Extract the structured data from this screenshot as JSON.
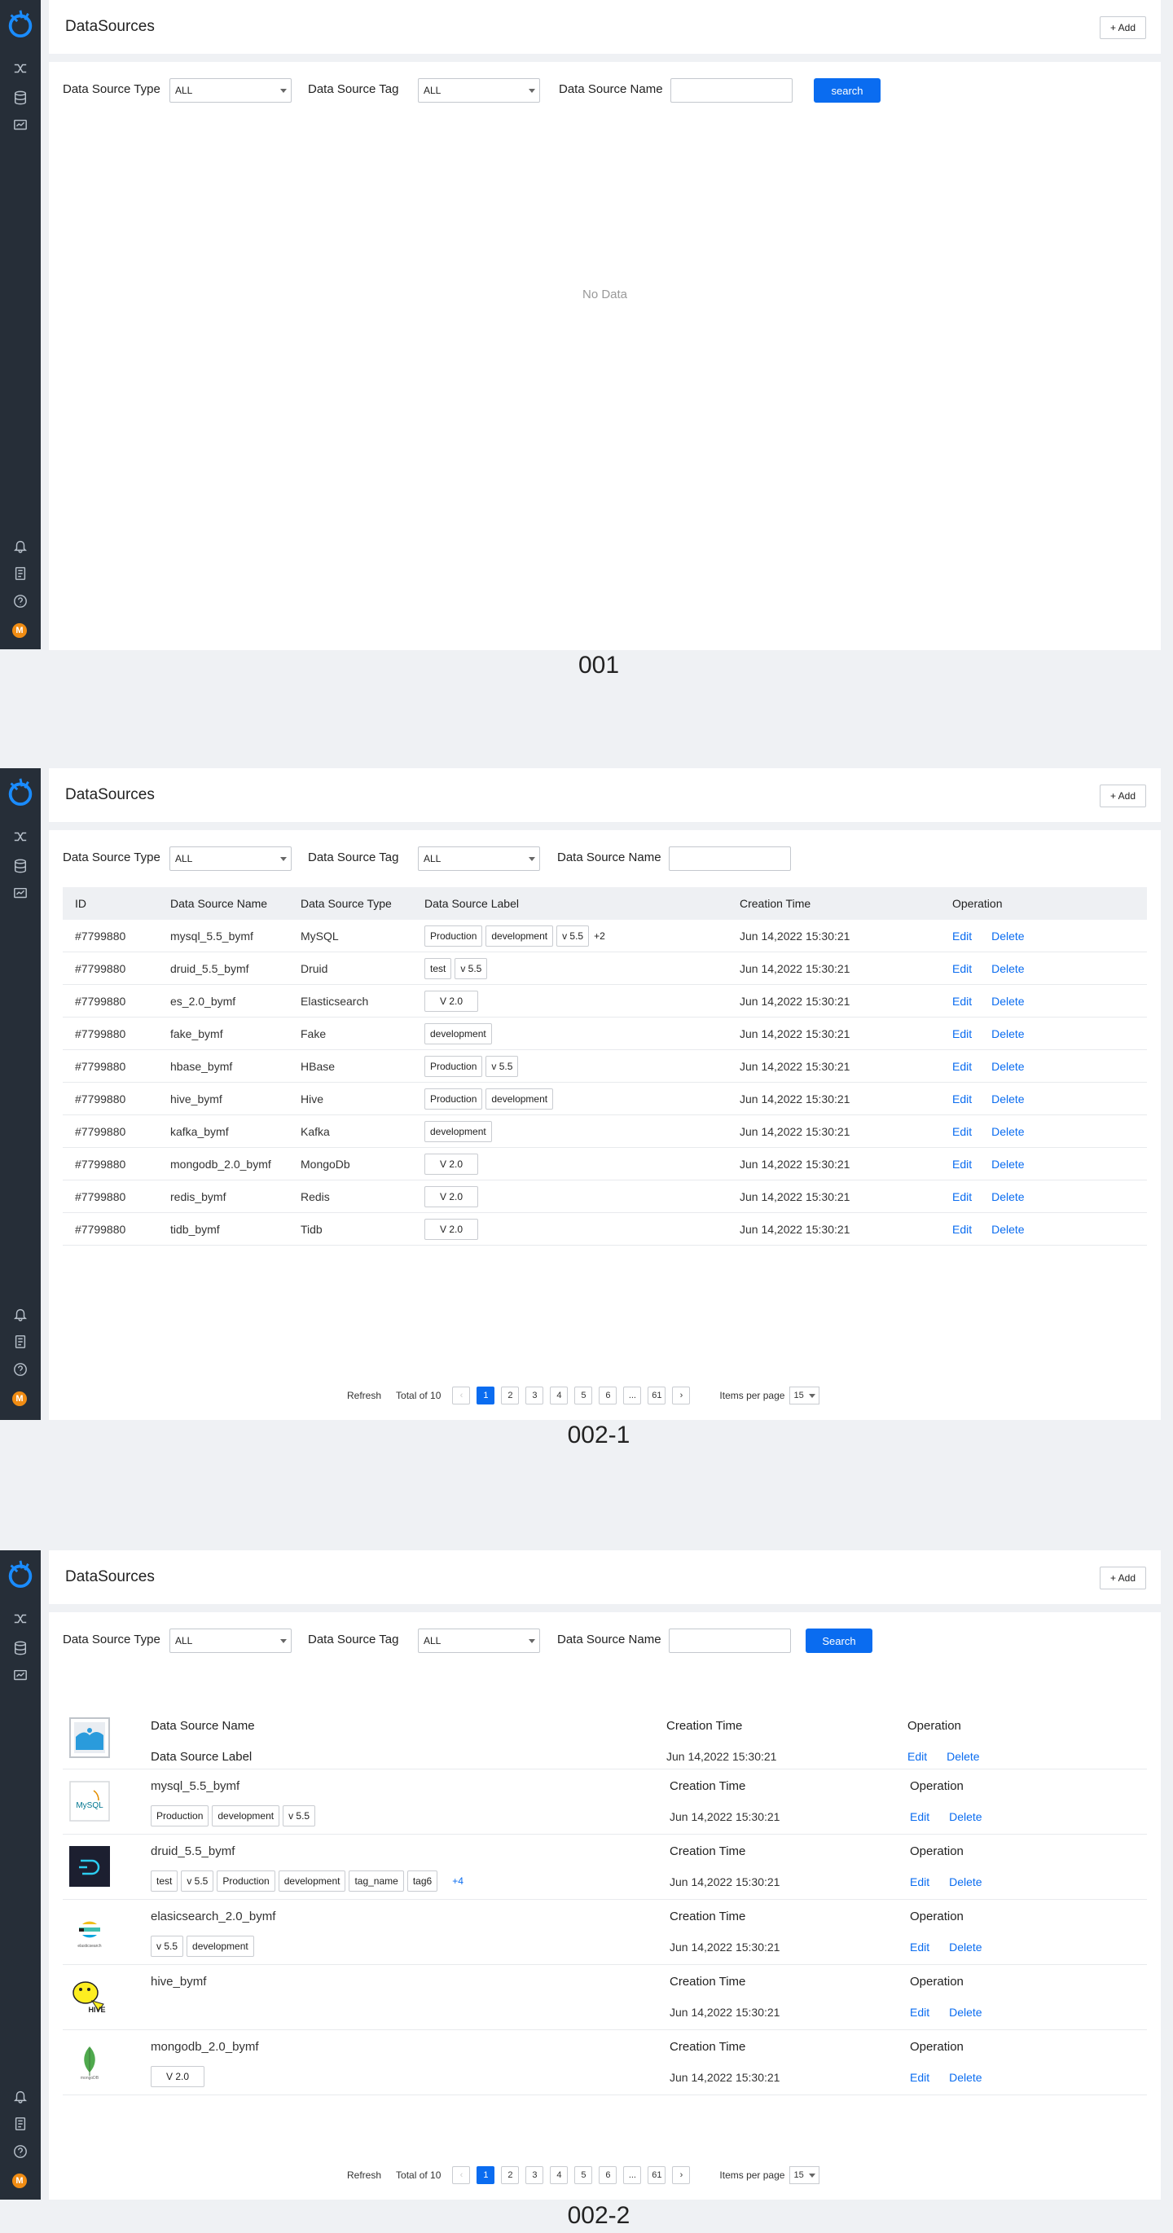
{
  "app": {
    "title": "DataSources",
    "add_label": "+ Add"
  },
  "filters": {
    "type_label": "Data Source Type",
    "tag_label": "Data Source Tag",
    "name_label": "Data Source Name",
    "type_value": "ALL",
    "tag_value": "ALL",
    "search_label_1": "search",
    "search_label_2": "Search"
  },
  "screen1": {
    "no_data": "No Data",
    "caption": "001"
  },
  "screen2": {
    "caption": "002-1",
    "columns": [
      "ID",
      "Data Source Name",
      "Data Source Type",
      "Data Source Label",
      "Creation Time",
      "Operation"
    ],
    "rows": [
      {
        "id": "#7799880",
        "name": "mysql_5.5_bymf",
        "type": "MySQL",
        "tags": [
          "Production",
          "development",
          "v 5.5"
        ],
        "more": "+2",
        "time": "Jun 14,2022 15:30:21"
      },
      {
        "id": "#7799880",
        "name": "druid_5.5_bymf",
        "type": "Druid",
        "tags": [
          "test",
          "v 5.5"
        ],
        "more": "",
        "time": "Jun 14,2022 15:30:21"
      },
      {
        "id": "#7799880",
        "name": "es_2.0_bymf",
        "type": "Elasticsearch",
        "tags": [
          "V 2.0"
        ],
        "more": "",
        "time": "Jun 14,2022 15:30:21"
      },
      {
        "id": "#7799880",
        "name": "fake_bymf",
        "type": "Fake",
        "tags": [
          "development"
        ],
        "more": "",
        "time": "Jun 14,2022 15:30:21"
      },
      {
        "id": "#7799880",
        "name": "hbase_bymf",
        "type": "HBase",
        "tags": [
          "Production",
          "v 5.5"
        ],
        "more": "",
        "time": "Jun 14,2022 15:30:21"
      },
      {
        "id": "#7799880",
        "name": "hive_bymf",
        "type": "Hive",
        "tags": [
          "Production",
          "development"
        ],
        "more": "",
        "time": "Jun 14,2022 15:30:21"
      },
      {
        "id": "#7799880",
        "name": "kafka_bymf",
        "type": "Kafka",
        "tags": [
          "development"
        ],
        "more": "",
        "time": "Jun 14,2022 15:30:21"
      },
      {
        "id": "#7799880",
        "name": "mongodb_2.0_bymf",
        "type": "MongoDb",
        "tags": [
          "V 2.0"
        ],
        "more": "",
        "time": "Jun 14,2022 15:30:21"
      },
      {
        "id": "#7799880",
        "name": "redis_bymf",
        "type": "Redis",
        "tags": [
          "V 2.0"
        ],
        "more": "",
        "time": "Jun 14,2022 15:30:21"
      },
      {
        "id": "#7799880",
        "name": "tidb_bymf",
        "type": "Tidb",
        "tags": [
          "V 2.0"
        ],
        "more": "",
        "time": "Jun 14,2022 15:30:21"
      }
    ]
  },
  "ops": {
    "edit": "Edit",
    "delete": "Delete"
  },
  "pagination": {
    "refresh": "Refresh",
    "total": "Total of 10",
    "pages": [
      "1",
      "2",
      "3",
      "4",
      "5",
      "6",
      "...",
      "61"
    ],
    "items_per_page": "Items per page",
    "per_page_value": "15"
  },
  "screen3": {
    "caption": "002-2",
    "header_card": {
      "name": "Data Source Name",
      "label": "Data Source Label",
      "time_label": "Creation Time",
      "time": "Jun 14,2022 15:30:21",
      "op_label": "Operation"
    },
    "cards": [
      {
        "name": "mysql_5.5_bymf",
        "icon": "mysql-logo-icon",
        "tags": [
          "Production",
          "development",
          "v 5.5"
        ],
        "more": "",
        "time_label": "Creation Time",
        "time": "Jun 14,2022 15:30:21",
        "op_label": "Operation"
      },
      {
        "name": "druid_5.5_bymf",
        "icon": "druid-logo-icon",
        "tags": [
          "test",
          "v 5.5",
          "Production",
          "development",
          "tag_name",
          "tag6"
        ],
        "more": "+4",
        "time_label": "Creation Time",
        "time": "Jun 14,2022 15:30:21",
        "op_label": "Operation"
      },
      {
        "name": "elasicsearch_2.0_bymf",
        "icon": "elasticsearch-logo-icon",
        "tags": [
          "v 5.5",
          "development"
        ],
        "more": "",
        "time_label": "Creation Time",
        "time": "Jun 14,2022 15:30:21",
        "op_label": "Operation"
      },
      {
        "name": "hive_bymf",
        "icon": "hive-logo-icon",
        "tags": [],
        "more": "",
        "time_label": "Creation Time",
        "time": "Jun 14,2022 15:30:21",
        "op_label": "Operation"
      },
      {
        "name": "mongodb_2.0_bymf",
        "icon": "mongodb-logo-icon",
        "tags": [
          "V 2.0"
        ],
        "more": "",
        "time_label": "Creation Time",
        "time": "Jun 14,2022 15:30:21",
        "op_label": "Operation"
      }
    ],
    "logo_texts": {
      "mysql": "MySQL",
      "hive": "HIVE",
      "elastic": "elasticsearch",
      "mongo": "mongoDB"
    }
  },
  "colors": {
    "sidebar": "#262e38",
    "accent": "#0a6cf0",
    "avatar": "#f08c13",
    "page_bg": "#eff1f4"
  },
  "avatar_letter": "M"
}
